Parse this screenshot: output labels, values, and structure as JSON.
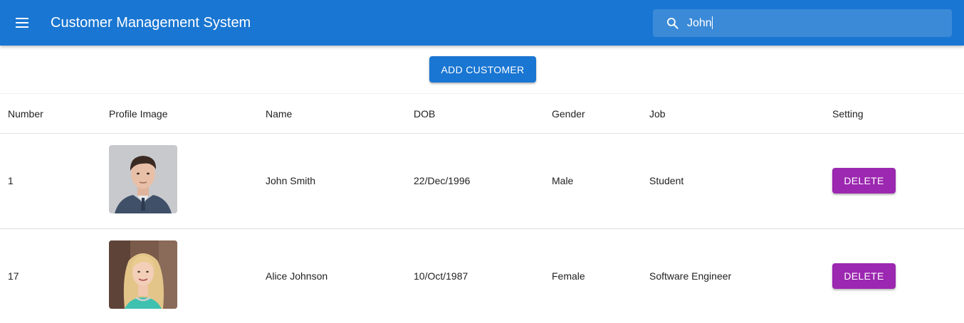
{
  "appbar": {
    "title": "Customer Management System",
    "menu_icon": "menu-icon",
    "search": {
      "icon": "search-icon",
      "value": "John",
      "placeholder": "Search"
    }
  },
  "toolbar": {
    "add_label": "ADD CUSTOMER"
  },
  "table": {
    "headers": [
      "Number",
      "Profile Image",
      "Name",
      "DOB",
      "Gender",
      "Job",
      "Setting"
    ],
    "rows": [
      {
        "number": "1",
        "image": "profile-photo-man",
        "name": "John Smith",
        "dob": "22/Dec/1996",
        "gender": "Male",
        "job": "Student",
        "action": "DELETE"
      },
      {
        "number": "17",
        "image": "profile-photo-woman",
        "name": "Alice Johnson",
        "dob": "10/Oct/1987",
        "gender": "Female",
        "job": "Software Engineer",
        "action": "DELETE"
      }
    ]
  },
  "colors": {
    "primary": "#1976d2",
    "secondary": "#9c27b0"
  }
}
